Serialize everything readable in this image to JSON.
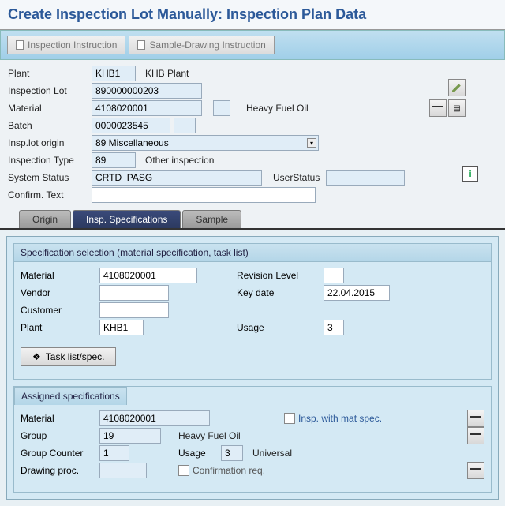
{
  "title": "Create Inspection Lot Manually: Inspection Plan Data",
  "toolbar": {
    "btn1": "Inspection Instruction",
    "btn2": "Sample-Drawing Instruction"
  },
  "header": {
    "plant_label": "Plant",
    "plant": "KHB1",
    "plant_desc": "KHB Plant",
    "insplot_label": "Inspection Lot",
    "insplot": "890000000203",
    "material_label": "Material",
    "material": "4108020001",
    "material_desc": "Heavy Fuel Oil",
    "batch_label": "Batch",
    "batch": "0000023545",
    "origin_label": "Insp.lot origin",
    "origin": "89 Miscellaneous",
    "type_label": "Inspection Type",
    "type": "89",
    "type_desc": "Other inspection",
    "sysstat_label": "System Status",
    "sysstat": "CRTD  PASG",
    "userstat_label": "UserStatus",
    "userstat": "",
    "confirm_label": "Confirm. Text",
    "confirm": ""
  },
  "tabs": {
    "t1": "Origin",
    "t2": "Insp. Specifications",
    "t3": "Sample"
  },
  "spec": {
    "title": "Specification selection (material specification, task list)",
    "material_label": "Material",
    "material": "4108020001",
    "rev_label": "Revision Level",
    "rev": "",
    "vendor_label": "Vendor",
    "vendor": "",
    "key_label": "Key date",
    "key": "22.04.2015",
    "customer_label": "Customer",
    "customer": "",
    "plant_label": "Plant",
    "plant": "KHB1",
    "usage_label": "Usage",
    "usage": "3",
    "tlbtn": "Task list/spec."
  },
  "assigned": {
    "title": "Assigned specifications",
    "material_label": "Material",
    "material": "4108020001",
    "inspmat_label": "Insp. with mat spec.",
    "group_label": "Group",
    "group": "19",
    "group_desc": "Heavy Fuel Oil",
    "counter_label": "Group Counter",
    "counter": "1",
    "usage_label": "Usage",
    "usage": "3",
    "usage_desc": "Universal",
    "draw_label": "Drawing proc.",
    "draw": "",
    "confreq_label": "Confirmation req."
  }
}
